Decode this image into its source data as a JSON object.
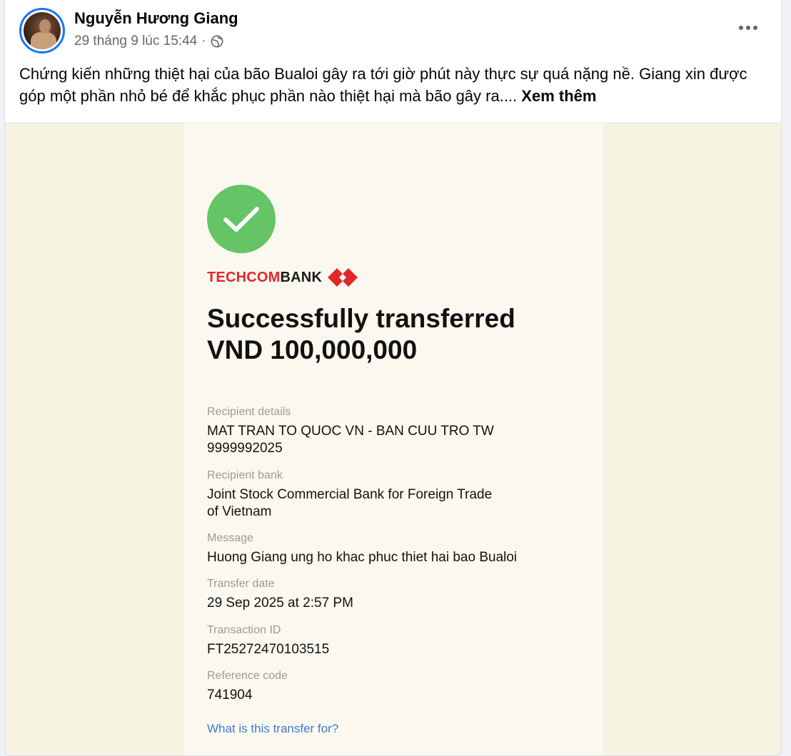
{
  "post": {
    "author": "Nguyễn Hương Giang",
    "timestamp": "29 tháng 9 lúc 15:44",
    "separator": "·",
    "privacy_icon": "globe-icon",
    "more_icon": "more-options-icon",
    "text": "Chứng kiến những thiệt hại của bão Bualoi gây ra tới giờ phút này thực sự quá nặng nề. Giang xin được góp một phần nhỏ bé để khắc phục phần nào thiệt hại mà bão gây ra....",
    "see_more": "Xem thêm"
  },
  "receipt": {
    "status_icon": "checkmark-icon",
    "bank_name_red": "TECHCOM",
    "bank_name_dark": "BANK",
    "headline_line1": "Successfully transferred",
    "headline_line2": "VND 100,000,000",
    "recipient_label": "Recipient details",
    "recipient_name": "MAT TRAN TO QUOC VN - BAN CUU TRO TW",
    "recipient_account": "9999992025",
    "bank_label": "Recipient bank",
    "bank_line1": "Joint Stock Commercial Bank for Foreign Trade",
    "bank_line2": "of Vietnam",
    "message_label": "Message",
    "message": "Huong Giang ung ho khac phuc thiet hai bao Bualoi",
    "date_label": "Transfer date",
    "date": "29 Sep 2025 at 2:57 PM",
    "txid_label": "Transaction ID",
    "txid": "FT25272470103515",
    "ref_label": "Reference code",
    "ref": "741904",
    "purpose_link": "What is this transfer for?"
  },
  "colors": {
    "facebook_blue": "#1877f2",
    "success_green": "#65c466",
    "techcombank_red": "#e3262a",
    "link_blue": "#3d7ad6"
  }
}
